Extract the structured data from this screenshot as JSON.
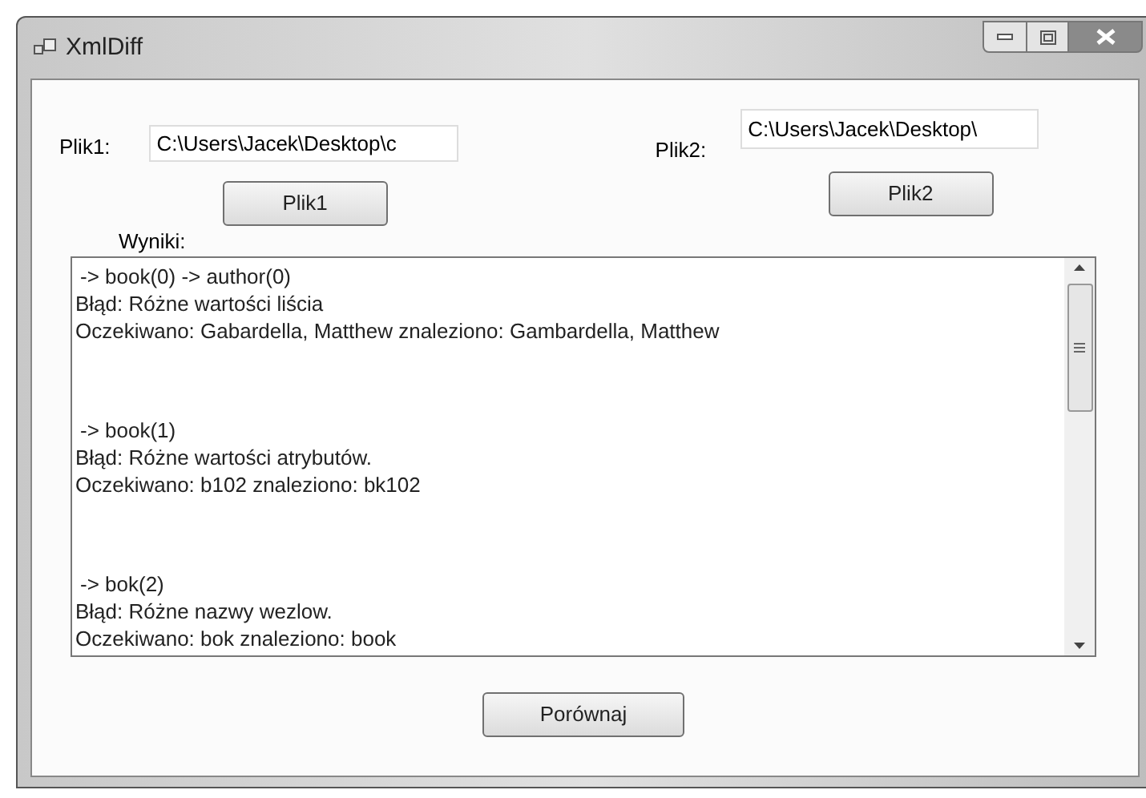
{
  "window": {
    "title": "XmlDiff"
  },
  "file1": {
    "label": "Plik1:",
    "value": "C:\\Users\\Jacek\\Desktop\\c",
    "button": "Plik1"
  },
  "file2": {
    "label": "Plik2:",
    "value": "C:\\Users\\Jacek\\Desktop\\",
    "button": "Plik2"
  },
  "results_label": "Wyniki:",
  "results": [
    {
      "path": "-> book(0) -> author(0)",
      "error": "Błąd: Różne wartości liścia",
      "expected": "Oczekiwano: Gabardella, Matthew znaleziono: Gambardella, Matthew"
    },
    {
      "path": "-> book(1)",
      "error": "Błąd: Różne wartości atrybutów.",
      "expected": "Oczekiwano: b102 znaleziono: bk102"
    },
    {
      "path": "-> bok(2)",
      "error": "Błąd: Różne nazwy wezlow.",
      "expected": "Oczekiwano: bok znaleziono: book"
    }
  ],
  "compare_button": "Porównaj"
}
